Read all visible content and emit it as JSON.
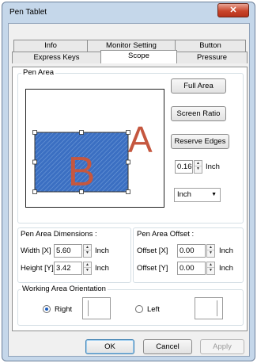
{
  "window": {
    "title": "Pen Tablet",
    "close_icon": "close-icon"
  },
  "tabs_row1": [
    "Info",
    "Monitor Setting",
    "Button"
  ],
  "tabs_row2": [
    "Express Keys",
    "Scope",
    "Pressure"
  ],
  "active_tab": "Scope",
  "pen_area": {
    "group_label": "Pen Area",
    "outer_letter": "A",
    "inner_letter": "B",
    "outer_letter_color": "#c5573f",
    "inner_fill_color": "#3b6fc2"
  },
  "side_buttons": {
    "full_area": "Full Area",
    "screen_ratio": "Screen Ratio",
    "reserve_edges": "Reserve Edges"
  },
  "reserve": {
    "value": "0.16",
    "unit": "Inch"
  },
  "unit_select": {
    "value": "Inch"
  },
  "dimensions": {
    "label": "Pen Area Dimensions :",
    "width_label": "Width [X]",
    "width_value": "5.60",
    "width_unit": "Inch",
    "height_label": "Height [Y]",
    "height_value": "3.42",
    "height_unit": "Inch"
  },
  "offset": {
    "label": "Pen Area Offset :",
    "x_label": "Offset [X]",
    "x_value": "0.00",
    "x_unit": "Inch",
    "y_label": "Offset [Y]",
    "y_value": "0.00",
    "y_unit": "Inch"
  },
  "orientation": {
    "label": "Working Area Orientation",
    "right": "Right",
    "left": "Left",
    "selected": "Right"
  },
  "dialog_buttons": {
    "ok": "OK",
    "cancel": "Cancel",
    "apply": "Apply"
  }
}
